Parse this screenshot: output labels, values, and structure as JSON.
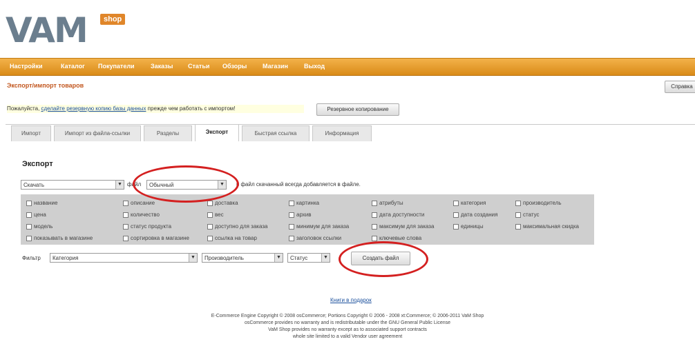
{
  "brand": {
    "logo_text": "VAM",
    "shop_badge": "shop"
  },
  "menu": [
    "Настройки",
    "Каталог",
    "Покупатели",
    "Заказы",
    "Статьи",
    "Обзоры",
    "Магазин",
    "Выход"
  ],
  "page_title": "Экспорт/импорт товаров",
  "top_right_button": "Справка",
  "notice": {
    "prefix": "Пожалуйста, ",
    "link": "сделайте резервную копию базы данных",
    "suffix": " прежде чем работать с импортом!",
    "button": "Резервное копирование"
  },
  "tabs": [
    {
      "label": "Импорт",
      "active": false
    },
    {
      "label": "Импорт из файла-ссылки",
      "active": false
    },
    {
      "label": "Разделы",
      "active": false
    },
    {
      "label": "Экспорт",
      "active": true
    },
    {
      "label": "Быстрая ссылка",
      "active": false
    },
    {
      "label": "Информация",
      "active": false
    }
  ],
  "export": {
    "title": "Экспорт",
    "action_select": "Скачать",
    "format_label": "файл",
    "format_select": "Обычный",
    "format_hint": "в файл скачанный всегда добавляется в файле.",
    "fields": [
      [
        "название",
        "описание",
        "доставка",
        "картинка",
        "атрибуты",
        "категория",
        "производитель"
      ],
      [
        "цена",
        "количество",
        "вес",
        "архив",
        "дата доступности",
        "дата создания",
        "статус"
      ],
      [
        "модель",
        "статус продукта",
        "доступно для заказа",
        "минимум для заказа",
        "максимум для заказа",
        "единицы",
        "максимальная скидка"
      ],
      [
        "показывать в магазине",
        "сортировка в магазине",
        "ссылка на товар",
        "заголовок ссылки",
        "ключевые слова",
        "",
        ""
      ]
    ],
    "filter_label": "Фильтр",
    "filter_category": "Категория",
    "filter_manufacturer": "Производитель",
    "filter_status": "Статус",
    "create_button": "Создать файл"
  },
  "footer": {
    "link": "Книги в подарок",
    "lines": [
      "E-Commerce Engine Copyright © 2008 osCommerce; Portions Copyright © 2006 - 2008 xt:Commerce; © 2006-2011 VaM Shop",
      "osCommerce provides no warranty and is redistributable under the GNU General Public License",
      "VaM Shop provides no warranty except as to associated support contracts",
      "whole site limited to a valid Vendor user agreement"
    ]
  },
  "colors": {
    "accent": "#e0862a",
    "menu_bg": "#e89e2e",
    "highlight_circle": "#d42020",
    "link": "#1a4f9c"
  }
}
